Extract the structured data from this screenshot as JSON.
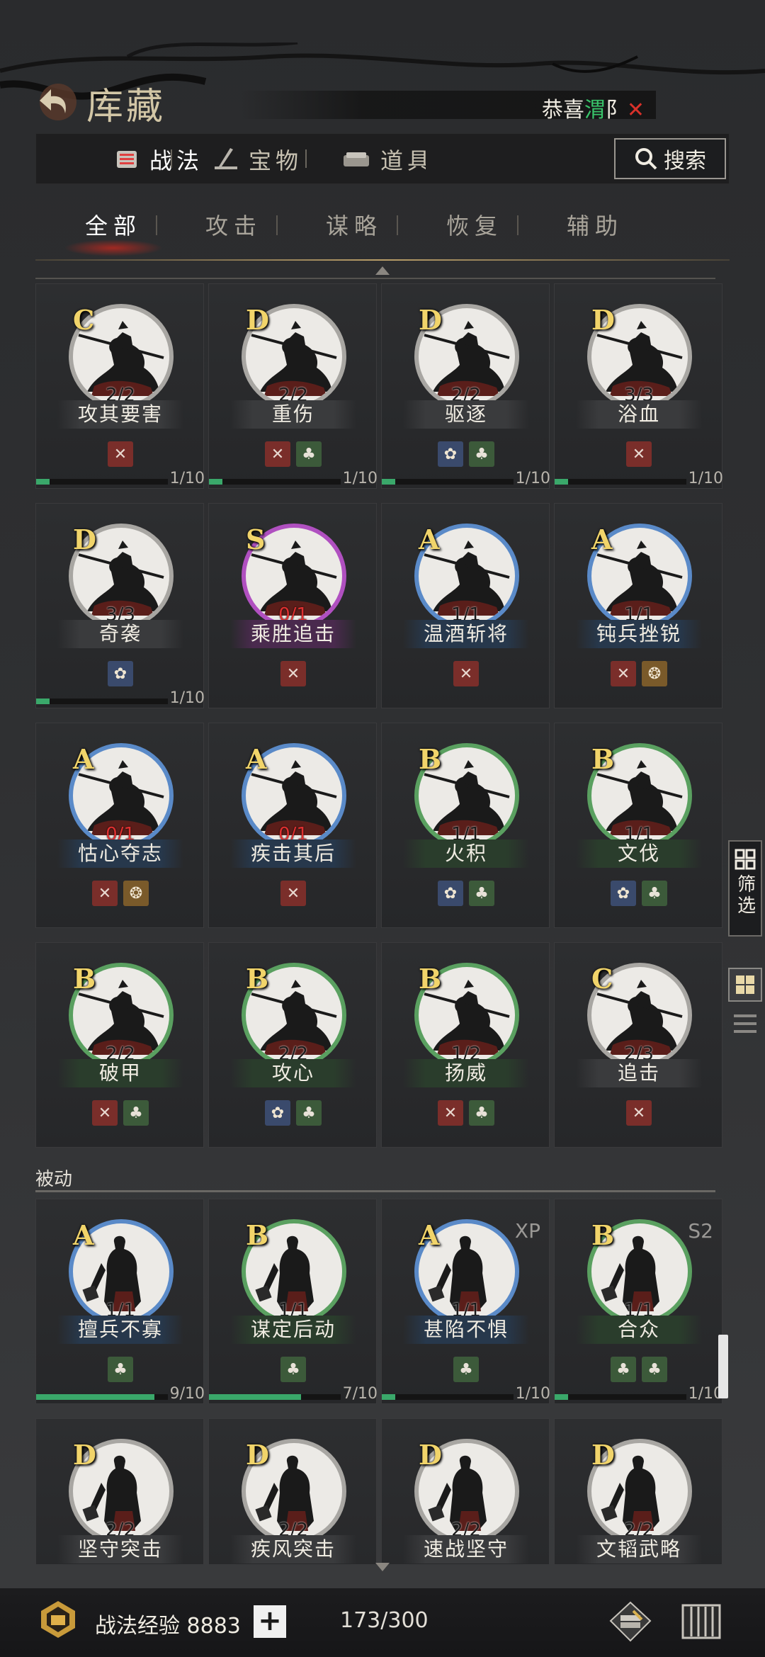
{
  "header": {
    "title": "库藏",
    "notice_prefix": "恭喜",
    "notice_highlight": "渭",
    "notice_suffix": "阝"
  },
  "category_tabs": [
    {
      "label": "战法",
      "icon": "scroll-icon",
      "active": true
    },
    {
      "label": "宝物",
      "icon": "treasure-icon",
      "active": false
    },
    {
      "label": "道具",
      "icon": "item-icon",
      "active": false
    }
  ],
  "search_label": "搜索",
  "sub_tabs": [
    {
      "label": "全部",
      "active": true
    },
    {
      "label": "攻击",
      "active": false
    },
    {
      "label": "谋略",
      "active": false
    },
    {
      "label": "恢复",
      "active": false
    },
    {
      "label": "辅助",
      "active": false
    }
  ],
  "section_passive": "被动",
  "filter_label": "筛选",
  "cards_active": [
    {
      "grade": "C",
      "count": "2/2",
      "name": "攻其要害",
      "icons": [
        "attack"
      ],
      "progress": "1/10",
      "pct": 0.1
    },
    {
      "grade": "D",
      "count": "2/2",
      "name": "重伤",
      "icons": [
        "attack",
        "heal"
      ],
      "progress": "1/10",
      "pct": 0.1
    },
    {
      "grade": "D",
      "count": "2/2",
      "name": "驱逐",
      "icons": [
        "intel",
        "heal"
      ],
      "progress": "1/10",
      "pct": 0.1
    },
    {
      "grade": "D",
      "count": "3/3",
      "name": "浴血",
      "icons": [
        "attack"
      ],
      "progress": "1/10",
      "pct": 0.1
    },
    {
      "grade": "D",
      "count": "3/3",
      "name": "奇袭",
      "icons": [
        "intel"
      ],
      "progress": "1/10",
      "pct": 0.1
    },
    {
      "grade": "S",
      "count": "0/1",
      "name": "乘胜追击",
      "icons": [
        "attack"
      ],
      "progress": "",
      "pct": 0,
      "ring": "purple",
      "red": true
    },
    {
      "grade": "A",
      "count": "1/1",
      "name": "温酒斩将",
      "icons": [
        "attack"
      ],
      "progress": "",
      "pct": 0,
      "ring": "blue"
    },
    {
      "grade": "A",
      "count": "1/1",
      "name": "钝兵挫锐",
      "icons": [
        "attack",
        "help"
      ],
      "progress": "",
      "pct": 0,
      "ring": "blue"
    },
    {
      "grade": "A",
      "count": "0/1",
      "name": "怙心夺志",
      "icons": [
        "attack",
        "help"
      ],
      "progress": "",
      "pct": 0,
      "ring": "blue",
      "red": true
    },
    {
      "grade": "A",
      "count": "0/1",
      "name": "疾击其后",
      "icons": [
        "attack"
      ],
      "progress": "",
      "pct": 0,
      "ring": "blue",
      "red": true
    },
    {
      "grade": "B",
      "count": "1/1",
      "name": "火积",
      "icons": [
        "intel",
        "heal"
      ],
      "progress": "",
      "pct": 0,
      "ring": "green"
    },
    {
      "grade": "B",
      "count": "1/1",
      "name": "文伐",
      "icons": [
        "intel",
        "heal"
      ],
      "progress": "",
      "pct": 0,
      "ring": "green"
    },
    {
      "grade": "B",
      "count": "2/2",
      "name": "破甲",
      "icons": [
        "attack",
        "heal"
      ],
      "progress": "",
      "pct": 0,
      "ring": "green"
    },
    {
      "grade": "B",
      "count": "2/2",
      "name": "攻心",
      "icons": [
        "intel",
        "heal"
      ],
      "progress": "",
      "pct": 0,
      "ring": "green"
    },
    {
      "grade": "B",
      "count": "1/2",
      "name": "扬威",
      "icons": [
        "attack",
        "heal"
      ],
      "progress": "",
      "pct": 0,
      "ring": "green"
    },
    {
      "grade": "C",
      "count": "2/3",
      "name": "追击",
      "icons": [
        "attack"
      ],
      "progress": "",
      "pct": 0
    }
  ],
  "cards_passive": [
    {
      "grade": "A",
      "count": "1/1",
      "name": "擅兵不寡",
      "icons": [
        "heal"
      ],
      "progress": "9/10",
      "pct": 0.9,
      "ring": "blue",
      "tag": ""
    },
    {
      "grade": "B",
      "count": "1/1",
      "name": "谋定后动",
      "icons": [
        "heal"
      ],
      "progress": "7/10",
      "pct": 0.7,
      "ring": "green",
      "tag": ""
    },
    {
      "grade": "A",
      "count": "1/1",
      "name": "甚陷不惧",
      "icons": [
        "heal"
      ],
      "progress": "1/10",
      "pct": 0.1,
      "ring": "blue",
      "tag": "XP"
    },
    {
      "grade": "B",
      "count": "1/1",
      "name": "合众",
      "icons": [
        "heal",
        "heal"
      ],
      "progress": "1/10",
      "pct": 0.1,
      "ring": "green",
      "tag": "S2"
    },
    {
      "grade": "D",
      "count": "2/2",
      "name": "坚守突击",
      "icons": [],
      "progress": "",
      "pct": 0,
      "tag": ""
    },
    {
      "grade": "D",
      "count": "2/2",
      "name": "疾风突击",
      "icons": [],
      "progress": "",
      "pct": 0,
      "tag": ""
    },
    {
      "grade": "D",
      "count": "2/2",
      "name": "速战坚守",
      "icons": [],
      "progress": "",
      "pct": 0,
      "tag": ""
    },
    {
      "grade": "D",
      "count": "2/2",
      "name": "文韬武略",
      "icons": [],
      "progress": "",
      "pct": 0,
      "tag": ""
    }
  ],
  "bottom": {
    "exp_label": "战法经验 8883",
    "plus": "+",
    "capacity": "173/300"
  },
  "colors": {
    "ring_purple": "#b050c0",
    "ring_blue": "#5a8ac8",
    "ring_green": "#5aa060",
    "ring_default": "#a8a6a2",
    "progress": "#3aa86a"
  }
}
